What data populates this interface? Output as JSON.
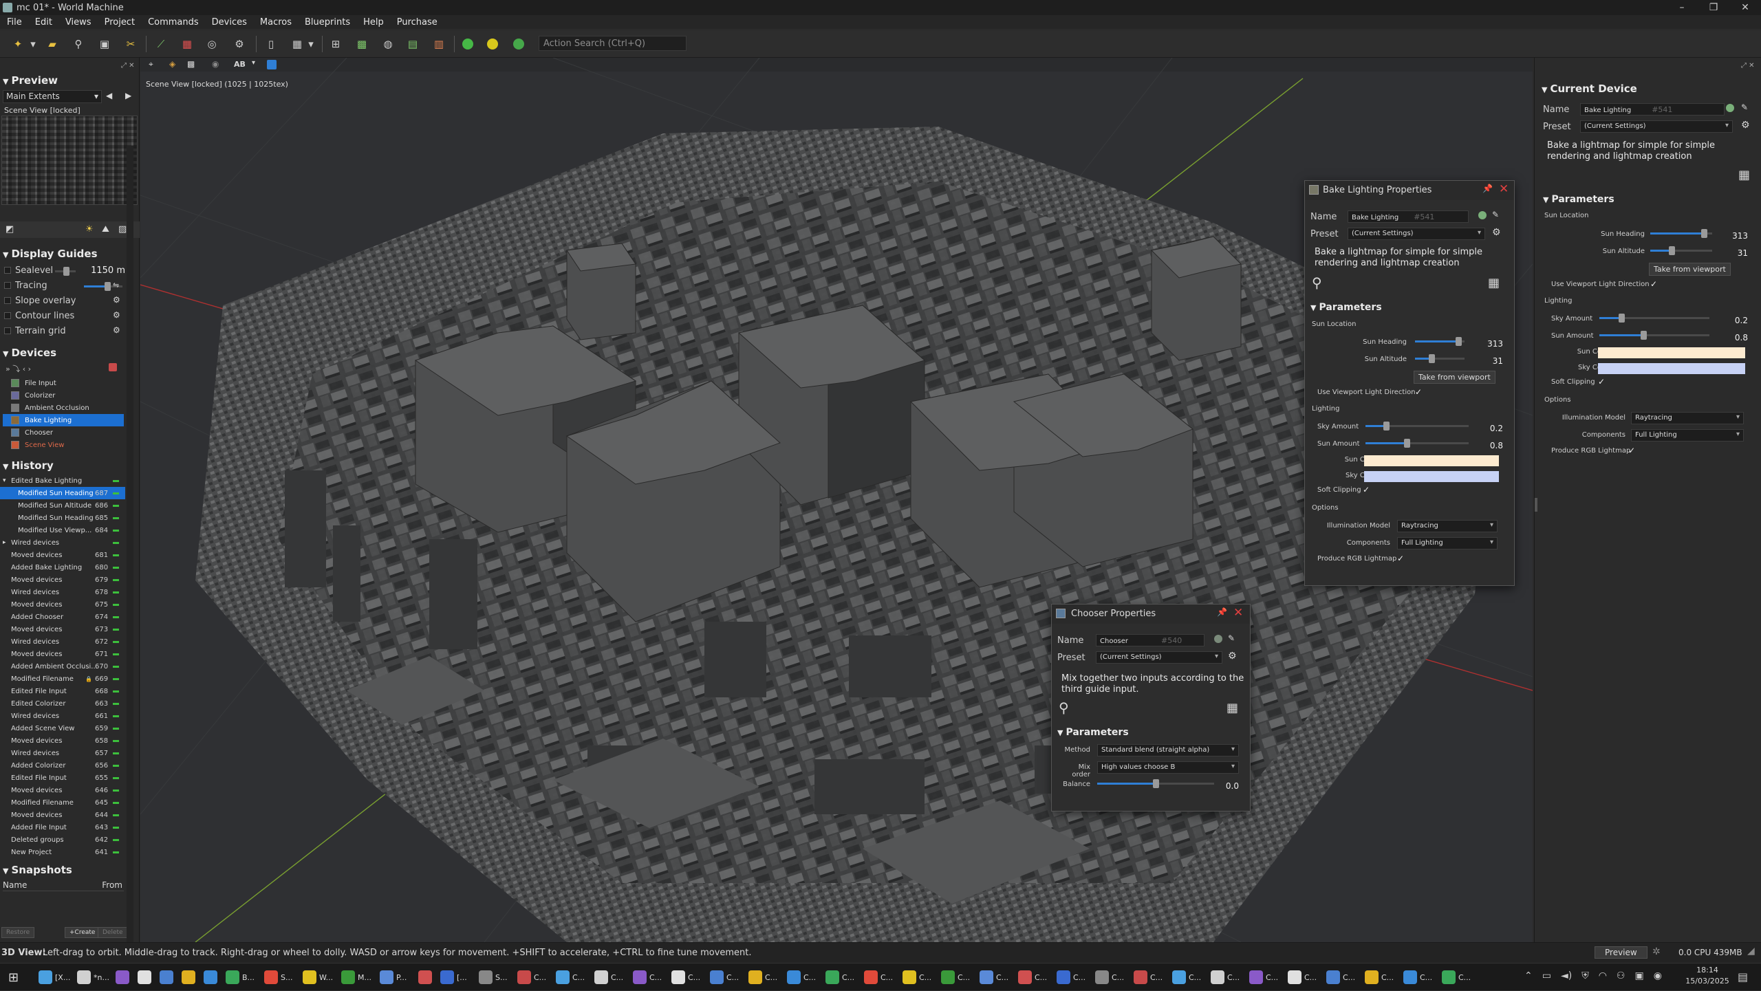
{
  "window": {
    "title": "mc 01* - World Machine",
    "min": "–",
    "max": "❐",
    "close": "✕"
  },
  "menu": [
    "File",
    "Edit",
    "Views",
    "Project",
    "Commands",
    "Devices",
    "Macros",
    "Blueprints",
    "Help",
    "Purchase"
  ],
  "toolbar": {
    "action_search_placeholder": "Action Search (Ctrl+Q)"
  },
  "preview": {
    "header": "Preview",
    "extents": "Main Extents",
    "prev": "◀",
    "next": "▶",
    "scene_label": "Scene View [locked]"
  },
  "display_guides": {
    "header": "Display Guides",
    "items": [
      {
        "label": "Sealevel",
        "value": "1150 m"
      },
      {
        "label": "Tracing",
        "value": ""
      },
      {
        "label": "Slope overlay",
        "value": ""
      },
      {
        "label": "Contour lines",
        "value": ""
      },
      {
        "label": "Terrain grid",
        "value": ""
      }
    ]
  },
  "devices": {
    "header": "Devices",
    "items": [
      {
        "label": "File Input",
        "color": "#5a8a5a",
        "selected": false
      },
      {
        "label": "Colorizer",
        "color": "#6a6a9a",
        "selected": false
      },
      {
        "label": "Ambient Occlusion",
        "color": "#7a7a7a",
        "selected": false
      },
      {
        "label": "Bake Lighting",
        "color": "#8a6a3a",
        "selected": true
      },
      {
        "label": "Chooser",
        "color": "#5a7a9a",
        "selected": false
      },
      {
        "label": "Scene View",
        "color": "#c85a3a",
        "selected": false
      }
    ]
  },
  "history": {
    "header": "History",
    "items": [
      {
        "label": "Edited Bake Lighting",
        "num": "",
        "level": 0,
        "expanded": true,
        "selected": false
      },
      {
        "label": "Modified Sun Heading",
        "num": "687",
        "level": 1,
        "selected": true
      },
      {
        "label": "Modified Sun Altitude",
        "num": "686",
        "level": 1,
        "selected": false
      },
      {
        "label": "Modified Sun Heading",
        "num": "685",
        "level": 1,
        "selected": false
      },
      {
        "label": "Modified Use Viewp...",
        "num": "684",
        "level": 1,
        "selected": false
      },
      {
        "label": "Wired devices",
        "num": "",
        "level": 0,
        "collapsed": true,
        "selected": false
      },
      {
        "label": "Moved devices",
        "num": "681",
        "level": 0,
        "selected": false
      },
      {
        "label": "Added Bake Lighting",
        "num": "680",
        "level": 0,
        "selected": false
      },
      {
        "label": "Moved devices",
        "num": "679",
        "level": 0,
        "selected": false
      },
      {
        "label": "Wired devices",
        "num": "678",
        "level": 0,
        "selected": false
      },
      {
        "label": "Moved devices",
        "num": "675",
        "level": 0,
        "selected": false
      },
      {
        "label": "Added Chooser",
        "num": "674",
        "level": 0,
        "selected": false
      },
      {
        "label": "Moved devices",
        "num": "673",
        "level": 0,
        "selected": false
      },
      {
        "label": "Wired devices",
        "num": "672",
        "level": 0,
        "selected": false
      },
      {
        "label": "Moved devices",
        "num": "671",
        "level": 0,
        "selected": false
      },
      {
        "label": "Added Ambient Occlusi...",
        "num": "670",
        "level": 0,
        "selected": false
      },
      {
        "label": "Modified Filename",
        "num": "669",
        "level": 0,
        "selected": false,
        "lock": true
      },
      {
        "label": "Edited File Input",
        "num": "668",
        "level": 0,
        "selected": false
      },
      {
        "label": "Edited Colorizer",
        "num": "663",
        "level": 0,
        "selected": false
      },
      {
        "label": "Wired devices",
        "num": "661",
        "level": 0,
        "selected": false
      },
      {
        "label": "Added Scene View",
        "num": "659",
        "level": 0,
        "selected": false
      },
      {
        "label": "Moved devices",
        "num": "658",
        "level": 0,
        "selected": false
      },
      {
        "label": "Wired devices",
        "num": "657",
        "level": 0,
        "selected": false
      },
      {
        "label": "Added Colorizer",
        "num": "656",
        "level": 0,
        "selected": false
      },
      {
        "label": "Edited File Input",
        "num": "655",
        "level": 0,
        "selected": false
      },
      {
        "label": "Moved devices",
        "num": "646",
        "level": 0,
        "selected": false
      },
      {
        "label": "Modified Filename",
        "num": "645",
        "level": 0,
        "selected": false
      },
      {
        "label": "Moved devices",
        "num": "644",
        "level": 0,
        "selected": false
      },
      {
        "label": "Added File Input",
        "num": "643",
        "level": 0,
        "selected": false
      },
      {
        "label": "Deleted groups",
        "num": "642",
        "level": 0,
        "selected": false
      },
      {
        "label": "New Project",
        "num": "641",
        "level": 0,
        "selected": false
      }
    ]
  },
  "snapshots": {
    "header": "Snapshots",
    "col_name": "Name",
    "col_from": "From",
    "restore": "Restore",
    "create": "+Create",
    "delete": "Delete"
  },
  "viewport": {
    "label": "Scene View [locked] (1025 | 1025tex)",
    "ab_label": "AB"
  },
  "bake_panel": {
    "title": "Bake Lighting Properties",
    "name_label": "Name",
    "name": "Bake Lighting",
    "id": "#541",
    "preset_label": "Preset",
    "preset": "(Current Settings)",
    "description": "Bake a lightmap for simple for simple rendering and lightmap creation",
    "params_header": "Parameters",
    "sun_location": "Sun Location",
    "sun_heading_label": "Sun Heading",
    "sun_heading": "313",
    "sun_heading_frac": 0.87,
    "sun_altitude_label": "Sun Altitude",
    "sun_altitude": "31",
    "sun_altitude_frac": 0.34,
    "take_from_viewport": "Take from viewport",
    "use_viewport_light": "Use Viewport Light Direction",
    "lighting": "Lighting",
    "sky_amount_label": "Sky Amount",
    "sky_amount": "0.2",
    "sky_amount_frac": 0.2,
    "sun_amount_label": "Sun Amount",
    "sun_amount": "0.8",
    "sun_amount_frac": 0.4,
    "sun_color_label": "Sun Color",
    "sun_color": "#fdebd0",
    "sky_color_label": "Sky Color",
    "sky_color": "#c7d2f5",
    "soft_clipping": "Soft Clipping",
    "options": "Options",
    "illum_label": "Illumination Model",
    "illum": "Raytracing",
    "components_label": "Components",
    "components": "Full Lighting",
    "rgb_label": "Produce RGB Lightmap",
    "check": "✓"
  },
  "chooser_panel": {
    "title": "Chooser Properties",
    "name_label": "Name",
    "name": "Chooser",
    "id": "#540",
    "preset_label": "Preset",
    "preset": "(Current Settings)",
    "description": "Mix together two inputs according to the third guide input.",
    "params_header": "Parameters",
    "method_label": "Method",
    "method": "Standard blend (straight alpha)",
    "mix_order_label": "Mix order",
    "mix_order": "High values choose B",
    "balance_label": "Balance",
    "balance": "0.0",
    "balance_frac": 0.5
  },
  "current_device": {
    "header": "Current Device",
    "name_label": "Name",
    "name": "Bake Lighting",
    "id": "#541",
    "preset_label": "Preset",
    "preset": "(Current Settings)",
    "description": "Bake a lightmap for simple for simple rendering and lightmap creation",
    "params_header": "Parameters",
    "sun_location": "Sun Location",
    "sun_heading_label": "Sun Heading",
    "sun_heading": "313",
    "sun_altitude_label": "Sun Altitude",
    "sun_altitude": "31",
    "take_from_viewport": "Take from viewport",
    "use_viewport_light": "Use Viewport Light Direction",
    "lighting": "Lighting",
    "sky_amount_label": "Sky Amount",
    "sky_amount": "0.2",
    "sun_amount_label": "Sun Amount",
    "sun_amount": "0.8",
    "sun_color_label": "Sun Color",
    "sky_color_label": "Sky Color",
    "soft_clipping": "Soft Clipping",
    "options": "Options",
    "illum_label": "Illumination Model",
    "illum": "Raytracing",
    "components_label": "Components",
    "components": "Full Lighting",
    "rgb_label": "Produce RGB Lightmap",
    "check": "✓"
  },
  "status": {
    "hint_bold": "3D View:",
    "hint": "Left-drag to orbit. Middle-drag to track. Right-drag or wheel to dolly. WASD or arrow keys for movement. +SHIFT to accelerate, +CTRL to fine tune movement.",
    "preview_btn": "Preview",
    "cpu": "0.0 CPU 439MB"
  },
  "taskbar": {
    "time": "18:14",
    "date": "15/03/2025",
    "items": [
      "[X...",
      "*n...",
      "",
      "",
      "",
      "",
      "",
      "B...",
      "S...",
      "W...",
      "M...",
      "P...",
      "",
      "[...",
      "S...",
      "C...",
      "C...",
      "C...",
      "C...",
      "C...",
      "C...",
      "C...",
      "C...",
      "C...",
      "C...",
      "C...",
      "C...",
      "C...",
      "C...",
      "C...",
      "C...",
      "C...",
      "C...",
      "C...",
      "C...",
      "C...",
      "C...",
      "C...",
      "C...",
      "C..."
    ]
  }
}
